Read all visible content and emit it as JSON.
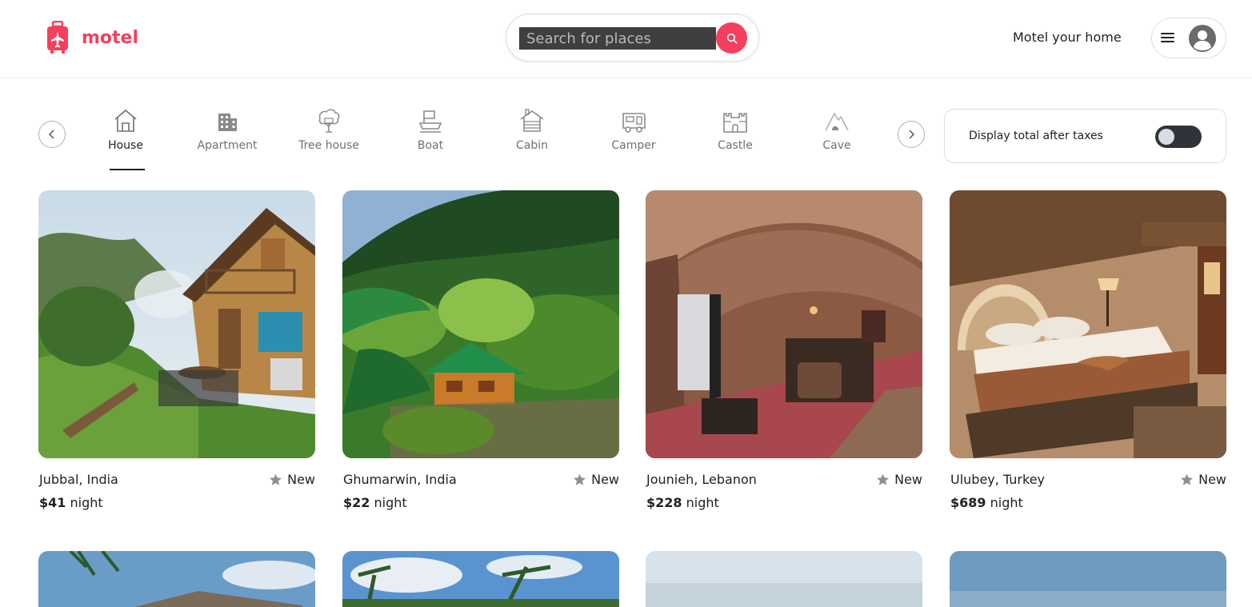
{
  "brand": {
    "name": "motel",
    "color": "#f43f5e",
    "icon": "suitcase-plane-icon"
  },
  "search": {
    "placeholder": "Search for places",
    "button_icon": "search-icon"
  },
  "header": {
    "host_link": "Motel your home",
    "menu_icon": "hamburger-icon",
    "avatar_icon": "user-circle-icon"
  },
  "categories": [
    {
      "label": "House",
      "icon": "house-icon",
      "active": true
    },
    {
      "label": "Apartment",
      "icon": "building-icon",
      "active": false
    },
    {
      "label": "Tree house",
      "icon": "tree-icon",
      "active": false
    },
    {
      "label": "Boat",
      "icon": "boat-icon",
      "active": false
    },
    {
      "label": "Cabin",
      "icon": "cabin-icon",
      "active": false
    },
    {
      "label": "Camper",
      "icon": "camper-icon",
      "active": false
    },
    {
      "label": "Castle",
      "icon": "castle-icon",
      "active": false
    },
    {
      "label": "Cave",
      "icon": "cave-icon",
      "active": false
    }
  ],
  "taxes": {
    "label": "Display total after taxes",
    "enabled": false
  },
  "listings": [
    {
      "location": "Jubbal, India",
      "badge": "New",
      "price": "$41",
      "unit": "night"
    },
    {
      "location": "Ghumarwin, India",
      "badge": "New",
      "price": "$22",
      "unit": "night"
    },
    {
      "location": "Jounieh, Lebanon",
      "badge": "New",
      "price": "$228",
      "unit": "night"
    },
    {
      "location": "Ulubey, Turkey",
      "badge": "New",
      "price": "$689",
      "unit": "night"
    }
  ]
}
